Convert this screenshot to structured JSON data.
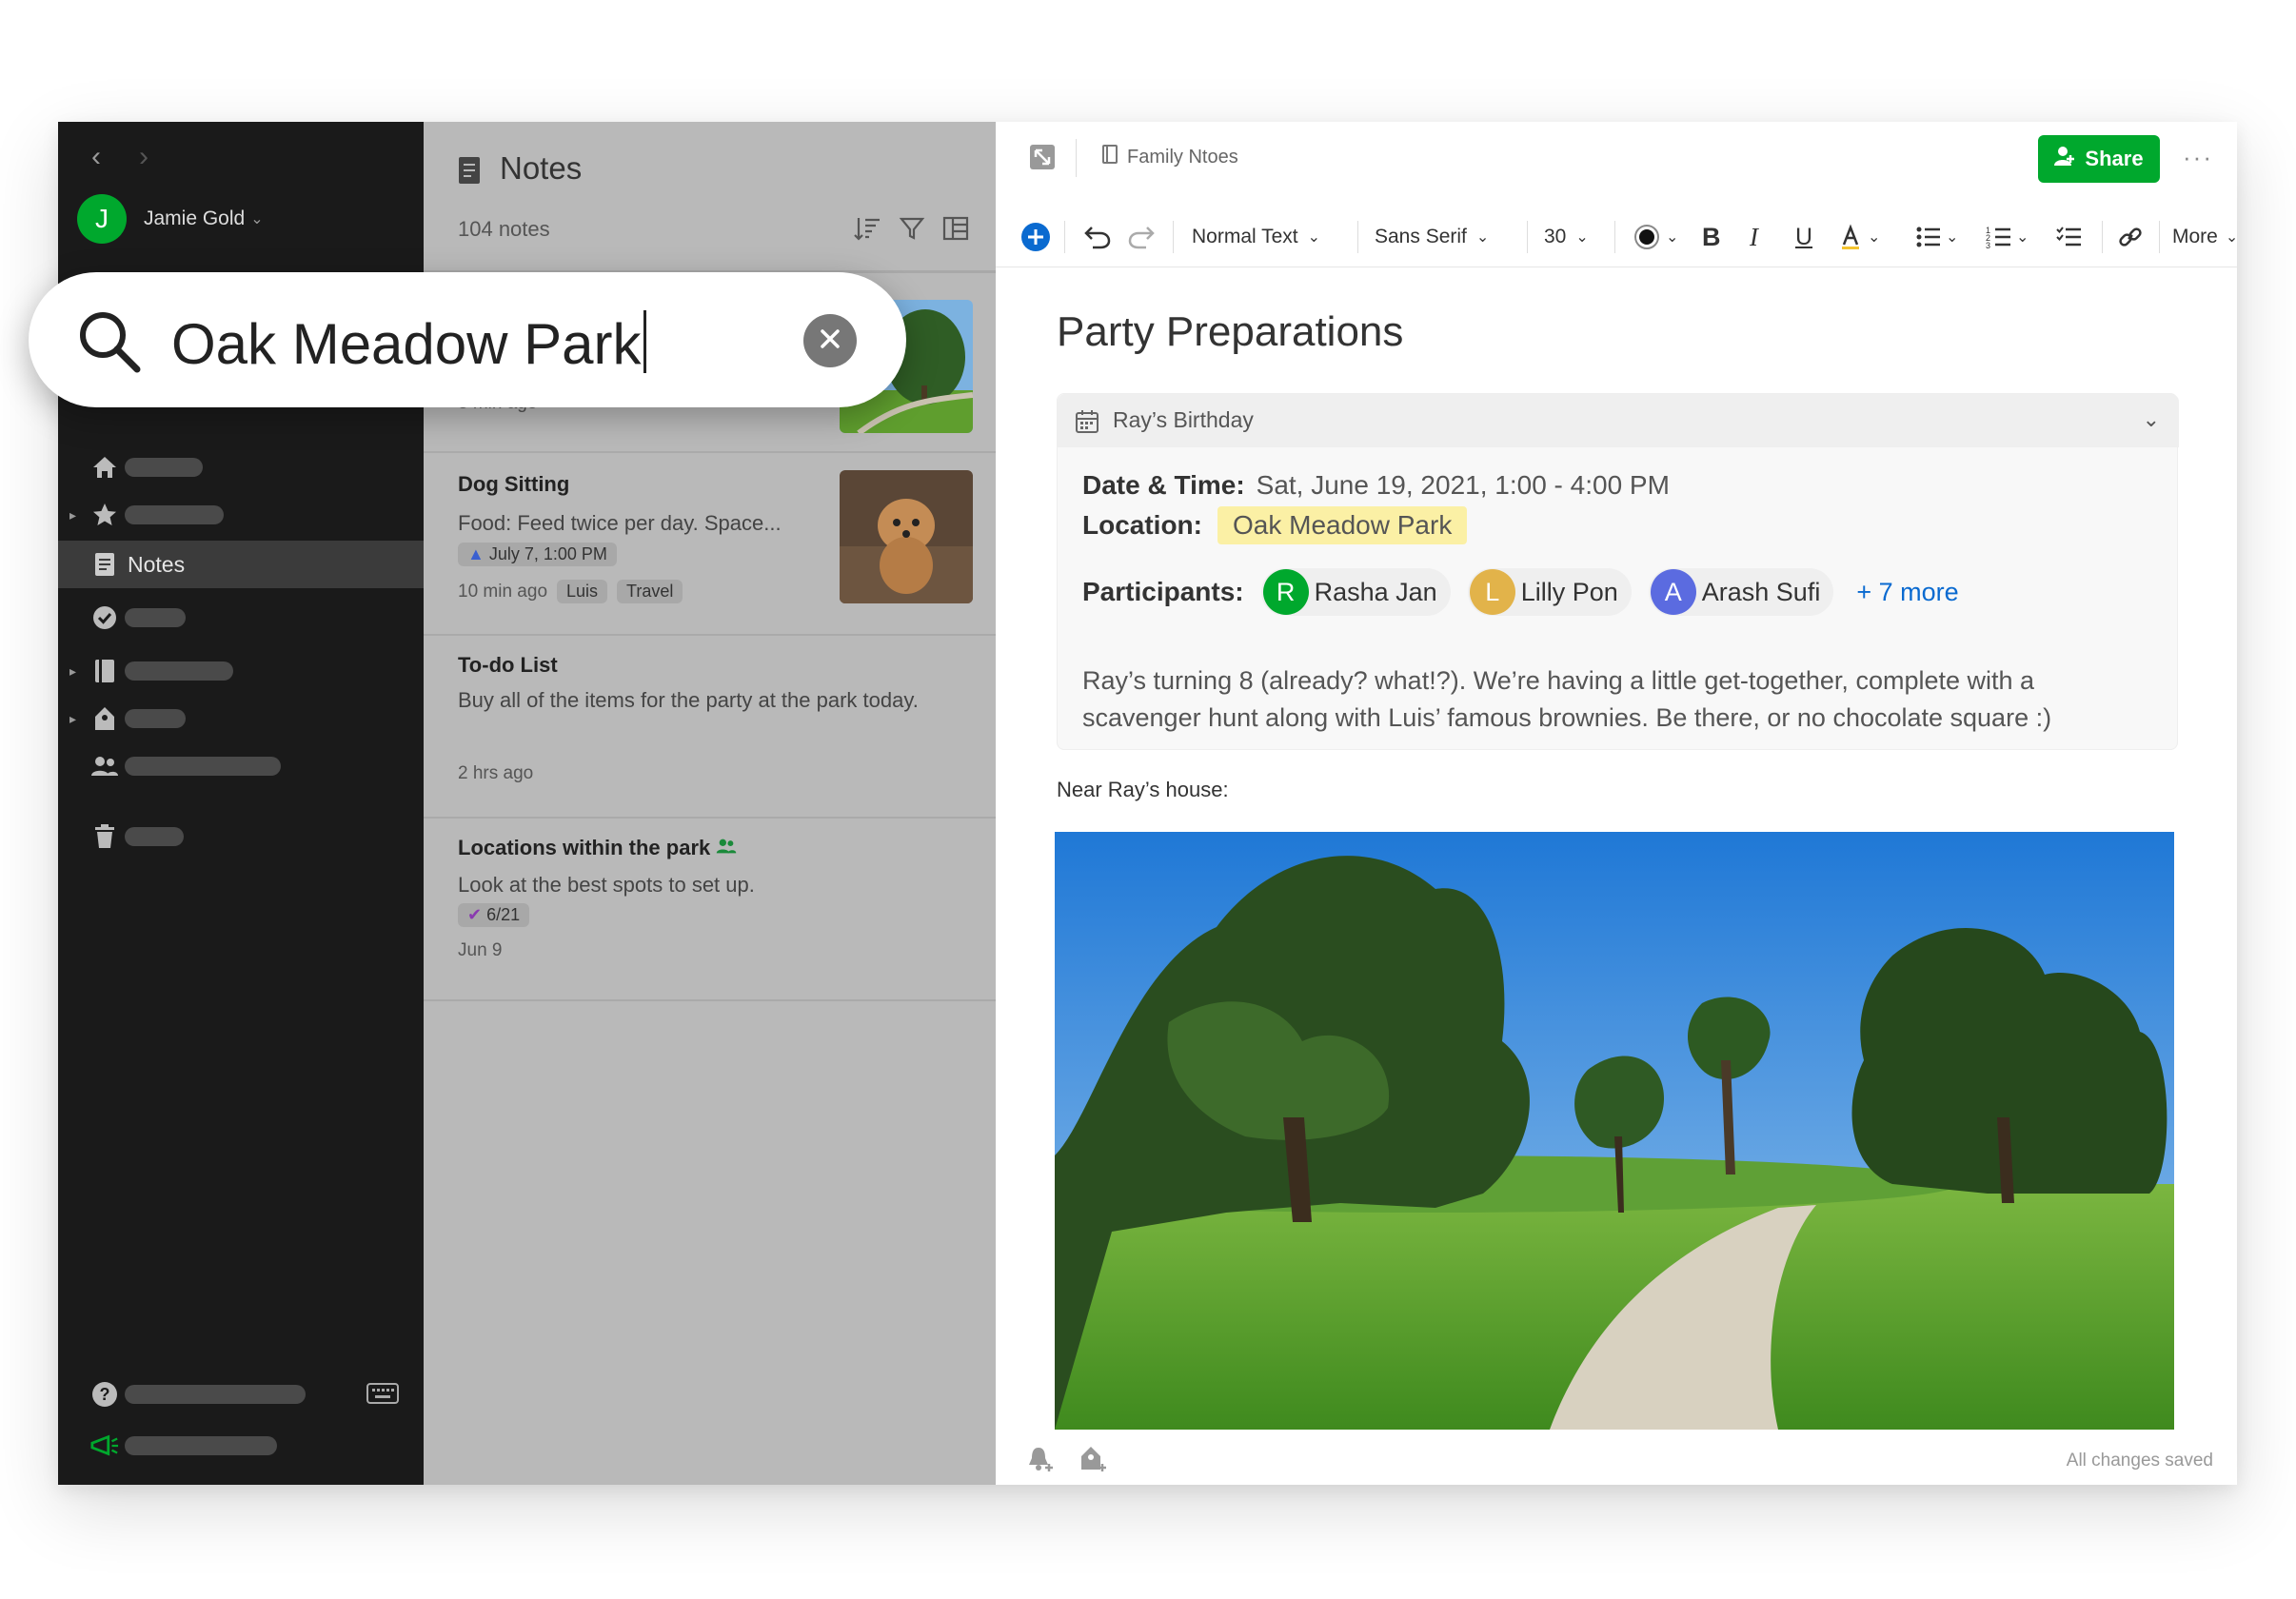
{
  "user": {
    "initial": "J",
    "name": "Jamie Gold"
  },
  "sidebar": {
    "active_item": "Notes"
  },
  "notes_list": {
    "title": "Notes",
    "count": "104 notes",
    "notes": [
      {
        "meta": "3 min ago"
      },
      {
        "title": "Dog Sitting",
        "snippet": "Food: Feed twice per day. Space...",
        "reminder": "July 7, 1:00 PM",
        "meta": "10 min ago",
        "tags": [
          "Luis",
          "Travel"
        ]
      },
      {
        "title": "To-do List",
        "snippet": "Buy all of the items for the party at the park today.",
        "meta": "2 hrs ago"
      },
      {
        "title": "Locations within the park",
        "snippet": "Look at the best spots to set up.",
        "task": "6/21",
        "meta": "Jun 9"
      }
    ]
  },
  "search": {
    "query": "Oak Meadow Park"
  },
  "editor": {
    "breadcrumb": "Family Ntoes",
    "share_label": "Share",
    "toolbar": {
      "style": "Normal Text",
      "font": "Sans Serif",
      "size": "30",
      "more": "More"
    },
    "note_title": "Party Preparations",
    "event": {
      "title": "Ray’s Birthday",
      "date_label": "Date & Time:",
      "date_value": "Sat, June 19, 2021, 1:00 - 4:00 PM",
      "location_label": "Location:",
      "location_value": "Oak Meadow Park",
      "participants_label": "Participants:",
      "participants": [
        {
          "initial": "R",
          "name": "Rasha Jan",
          "color": "#00a82d"
        },
        {
          "initial": "L",
          "name": "Lilly Pon",
          "color": "#e2b34a"
        },
        {
          "initial": "A",
          "name": "Arash Sufi",
          "color": "#5b6be0"
        }
      ],
      "more": "+ 7 more",
      "description": "Ray’s turning 8 (already? what!?). We’re having a little get-together, complete with a scavenger hunt along with Luis’ famous brownies. Be there, or no chocolate square :)"
    },
    "near_text": "Near Ray’s house:",
    "status": "All changes saved"
  },
  "colors": {
    "brand_green": "#00a82d",
    "sidebar_bg": "#1a1a1a",
    "list_bg": "#b9b9b9",
    "highlight": "#fbf0a5",
    "link": "#0a6ad0"
  }
}
